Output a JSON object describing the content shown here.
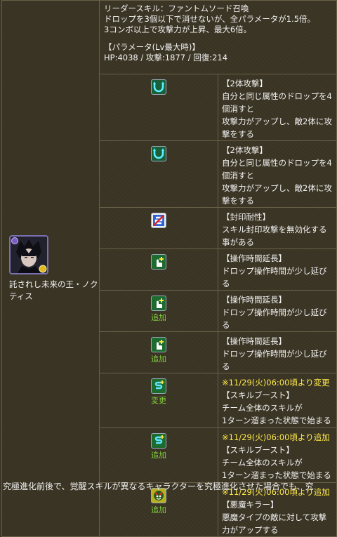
{
  "leader": {
    "line1": "リーダースキル：ファントムソード召喚",
    "line2": "ドロップを3個以下で消せないが、全パラメータが1.5倍。",
    "line3": "3コンボ以上で攻撃力が上昇、最大6倍。",
    "param_title": "【パラメータ(Lv最大時)】",
    "param_values": "HP:4038 / 攻撃:1877 / 回復:214"
  },
  "character": {
    "name": "託されし未来の王・ノクティス"
  },
  "awakenings": [
    {
      "icon": "two-way-attack-icon",
      "tag": "",
      "note": "",
      "title": "【2体攻撃】",
      "desc1": "自分と同じ属性のドロップを4個消すと",
      "desc2": "攻撃力がアップし、敵2体に攻撃をする"
    },
    {
      "icon": "two-way-attack-icon",
      "tag": "",
      "note": "",
      "title": "【2体攻撃】",
      "desc1": "自分と同じ属性のドロップを4個消すと",
      "desc2": "攻撃力がアップし、敵2体に攻撃をする"
    },
    {
      "icon": "skill-bind-resist-icon",
      "tag": "",
      "note": "",
      "title": "【封印耐性】",
      "desc1": "スキル封印攻撃を無効化する事がある",
      "desc2": ""
    },
    {
      "icon": "extend-time-icon",
      "tag": "",
      "note": "",
      "title": "【操作時間延長】",
      "desc1": "ドロップ操作時間が少し延びる",
      "desc2": ""
    },
    {
      "icon": "extend-time-icon",
      "tag": "追加",
      "note": "",
      "title": "【操作時間延長】",
      "desc1": "ドロップ操作時間が少し延びる",
      "desc2": ""
    },
    {
      "icon": "extend-time-icon",
      "tag": "追加",
      "note": "",
      "title": "【操作時間延長】",
      "desc1": "ドロップ操作時間が少し延びる",
      "desc2": ""
    },
    {
      "icon": "skill-boost-icon",
      "tag": "変更",
      "note": "※11/29(火)06:00頃より変更",
      "title": "【スキルブースト】",
      "desc1": "チーム全体のスキルが",
      "desc2": "1ターン溜まった状態で始まる"
    },
    {
      "icon": "skill-boost-icon",
      "tag": "追加",
      "note": "※11/29(火)06:00頃より追加",
      "title": "【スキルブースト】",
      "desc1": "チーム全体のスキルが",
      "desc2": "1ターン溜まった状態で始まる"
    },
    {
      "icon": "devil-killer-icon",
      "tag": "追加",
      "note": "※11/29(火)06:00頃より追加",
      "title": "【悪魔キラー】",
      "desc1": "悪魔タイプの敵に対して攻撃力がアップする",
      "desc2": ""
    }
  ],
  "footer": {
    "text": "究極進化前後で、覚醒スキルが異なるキャラクターを究極進化させた場合でも、究"
  },
  "colors": {
    "background": "#3a3424",
    "border": "#6a6048",
    "note_yellow": "#ffea4a",
    "tag_green": "#7fcf3a"
  }
}
